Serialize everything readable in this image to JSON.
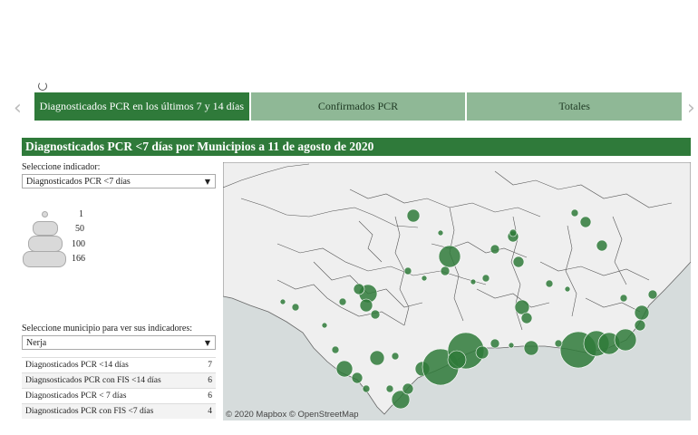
{
  "tabs": [
    {
      "label": "Diagnosticados PCR en los últimos 7 y 14 días",
      "active": true
    },
    {
      "label": "Confirmados PCR",
      "active": false
    },
    {
      "label": "Totales",
      "active": false
    }
  ],
  "title": "Diagnosticados PCR <7 días por Municipios a 11 de agosto de 2020",
  "indicator_select": {
    "label": "Seleccione indicador:",
    "value": "Diagnosticados PCR <7 días"
  },
  "legend": [
    "1",
    "50",
    "100",
    "166"
  ],
  "municipio_select": {
    "label": "Seleccione municipio para ver sus indicadores:",
    "value": "Nerja"
  },
  "indicators": [
    {
      "name": "Diagnosticados PCR <14 días",
      "value": "7"
    },
    {
      "name": "Diagnsosticados PCR con FIS <14 días",
      "value": "6"
    },
    {
      "name": "Diagnosticados PCR < 7 días",
      "value": "6"
    },
    {
      "name": "Diagnosticados PCR con FIS <7 días",
      "value": "4"
    }
  ],
  "map": {
    "credit": "© 2020 Mapbox  © OpenStreetMap",
    "bubble_color": "#2f7a3a",
    "land_color": "#efefef",
    "sea_color": "#d6dcdc"
  }
}
